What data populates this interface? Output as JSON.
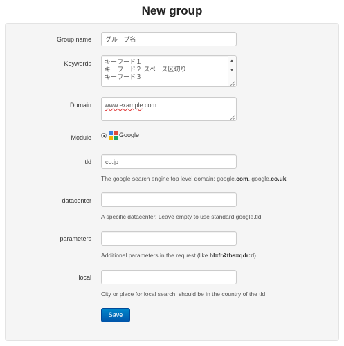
{
  "page": {
    "title": "New group"
  },
  "form": {
    "group_name": {
      "label": "Group name",
      "value": "グループ名"
    },
    "keywords": {
      "label": "Keywords",
      "lines": [
        "キーワード１",
        "キーワード２ スペース区切り",
        "キーワード３"
      ]
    },
    "domain": {
      "label": "Domain",
      "value_link": "www.example",
      "value_rest": ".com"
    },
    "module": {
      "label": "Module",
      "option": "Google",
      "selected": true,
      "icon": "google-module-icon"
    },
    "tld": {
      "label": "tld",
      "value": "co.jp",
      "help_prefix": "The google search engine top level domain: google.",
      "help_b1": "com",
      "help_mid": ", google.",
      "help_b2": "co.uk"
    },
    "datacenter": {
      "label": "datacenter",
      "value": "",
      "help": "A specific datacenter. Leave empty to use standard google.tld"
    },
    "parameters": {
      "label": "parameters",
      "value": "",
      "help_prefix": "Additional parameters in the request (like ",
      "help_b": "hl=fr&tbs=qdr:d",
      "help_suffix": ")"
    },
    "local": {
      "label": "local",
      "value": "",
      "help": "City or place for local search, should be in the country of the tld"
    },
    "save_label": "Save"
  },
  "colors": {
    "panel_bg": "#f5f5f5",
    "button_bg": "#0066bb",
    "spell_underline": "#dd3333"
  }
}
